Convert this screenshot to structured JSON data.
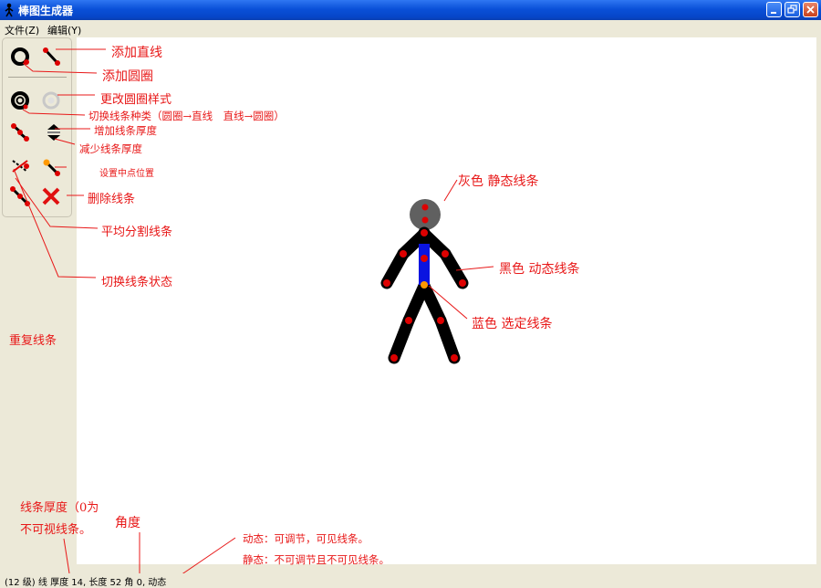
{
  "window": {
    "title": "棒图生成器"
  },
  "menu": {
    "file": "文件(Z)",
    "edit": "编辑(Y)"
  },
  "tools": {
    "add_circle": "add-circle-icon",
    "add_line": "add-line-icon",
    "change_circle_style": "circle-style-icon",
    "circle_style_alt": "circle-style-faded-icon",
    "toggle_type": "toggle-type-icon",
    "thickness_up_down": "thickness-arrows-icon",
    "split_line": "split-line-icon",
    "set_center": "set-center-icon",
    "toggle_state": "toggle-state-icon",
    "delete_line": "delete-icon"
  },
  "annotations": {
    "add_line": "添加直线",
    "add_circle": "添加圆圈",
    "change_circle_style": "更改圆圈样式",
    "toggle_line_type": "切换线条种类（圆圈→直线　直线→圆圈）",
    "increase_thickness": "增加线条厚度",
    "decrease_thickness": "减少线条厚度",
    "set_center": "设置中点位置",
    "delete_line": "删除线条",
    "split_line": "平均分割线条",
    "toggle_state": "切换线条状态",
    "repeat_line": "重复线条",
    "gray_static": "灰色  静态线条",
    "black_dynamic": "黑色  动态线条",
    "blue_selected": "蓝色  选定线条",
    "thickness_note_1": "线条厚度（0为",
    "thickness_note_2": "不可视线条。",
    "angle": "角度",
    "dynamic_note": "动态：可调节，可见线条。",
    "static_note": "静态：不可调节且不可见线条。"
  },
  "status": {
    "text": "(12 级)  线 厚度 14, 长度 52  角 0, 动态"
  },
  "colors": {
    "annotation": "#e81818",
    "static_gray": "#606060",
    "dynamic_black": "#000000",
    "selected_blue": "#0a14e0",
    "joint_red": "#dd0000",
    "joint_orange": "#ff9900"
  }
}
